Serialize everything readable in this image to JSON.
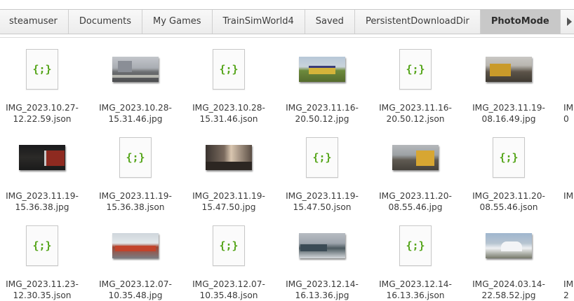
{
  "pathbar": {
    "crumbs": [
      "steamuser",
      "Documents",
      "My Games",
      "TrainSimWorld4",
      "Saved",
      "PersistentDownloadDir",
      "PhotoMode"
    ],
    "active_index": 6,
    "forward_icon": "chevron-right-icon"
  },
  "json_icon_glyph": "{;}",
  "files": [
    {
      "line1": "IMG_2023.10.27-",
      "line2": "12.22.59.json",
      "kind": "json"
    },
    {
      "line1": "IMG_2023.10.28-",
      "line2": "15.31.46.jpg",
      "kind": "photo",
      "photo": "station"
    },
    {
      "line1": "IMG_2023.10.28-",
      "line2": "15.31.46.json",
      "kind": "json"
    },
    {
      "line1": "IMG_2023.11.16-",
      "line2": "20.50.12.jpg",
      "kind": "photo",
      "photo": "field"
    },
    {
      "line1": "IMG_2023.11.16-",
      "line2": "20.50.12.json",
      "kind": "json"
    },
    {
      "line1": "IMG_2023.11.19-",
      "line2": "08.16.49.jpg",
      "kind": "photo",
      "photo": "yard"
    },
    {
      "line1": "IMG_2023.11.19-",
      "line2": "15.36.38.jpg",
      "kind": "photo",
      "photo": "night"
    },
    {
      "line1": "IMG_2023.11.19-",
      "line2": "15.36.38.json",
      "kind": "json"
    },
    {
      "line1": "IMG_2023.11.19-",
      "line2": "15.47.50.jpg",
      "kind": "photo",
      "photo": "platform"
    },
    {
      "line1": "IMG_2023.11.19-",
      "line2": "15.47.50.json",
      "kind": "json"
    },
    {
      "line1": "IMG_2023.11.20-",
      "line2": "08.55.46.jpg",
      "kind": "photo",
      "photo": "station2"
    },
    {
      "line1": "IMG_2023.11.20-",
      "line2": "08.55.46.json",
      "kind": "json"
    },
    {
      "line1": "IMG_2023.11.23-",
      "line2": "12.30.35.json",
      "kind": "json"
    },
    {
      "line1": "IMG_2023.12.07-",
      "line2": "10.35.48.jpg",
      "kind": "photo",
      "photo": "red"
    },
    {
      "line1": "IMG_2023.12.07-",
      "line2": "10.35.48.json",
      "kind": "json"
    },
    {
      "line1": "IMG_2023.12.14-",
      "line2": "16.13.36.jpg",
      "kind": "photo",
      "photo": "snow"
    },
    {
      "line1": "IMG_2023.12.14-",
      "line2": "16.13.36.json",
      "kind": "json"
    },
    {
      "line1": "IMG_2024.03.14-",
      "line2": "22.58.52.jpg",
      "kind": "photo",
      "photo": "tent"
    }
  ],
  "partial_column": {
    "row1_line1": "IM",
    "row1_line2": "0",
    "row2_line1": "IM",
    "row3_line1": "IM",
    "row3_line2": "2"
  }
}
